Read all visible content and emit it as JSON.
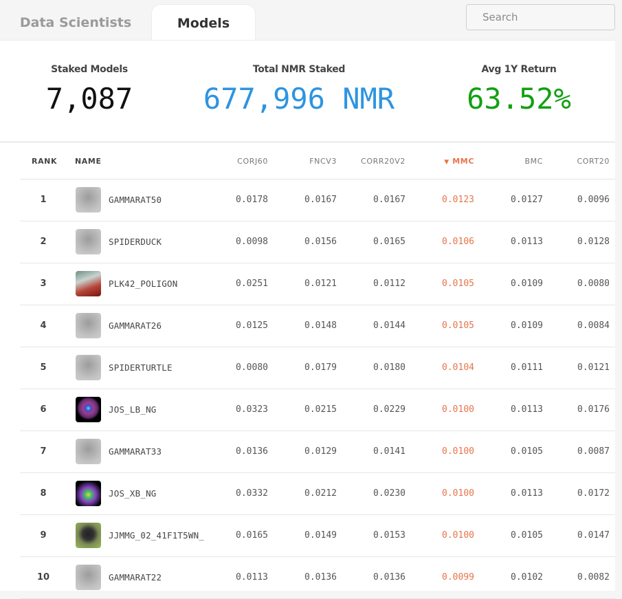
{
  "tabs": [
    {
      "label": "Data Scientists",
      "active": false
    },
    {
      "label": "Models",
      "active": true
    }
  ],
  "search": {
    "placeholder": "Search",
    "value": "",
    "icon": "search-icon"
  },
  "stats": [
    {
      "label": "Staked Models",
      "value": "7,087",
      "color": "#111111"
    },
    {
      "label": "Total NMR Staked",
      "value": "677,996 NMR",
      "color": "#2e94e0"
    },
    {
      "label": "Avg 1Y Return",
      "value": "63.52%",
      "color": "#12a012"
    }
  ],
  "table": {
    "columns": [
      "RANK",
      "NAME",
      "CORJ60",
      "FNCV3",
      "CORR20V2",
      "MMC",
      "BMC",
      "CORT20"
    ],
    "sort": {
      "column": "MMC",
      "direction": "desc",
      "indicator": "▼",
      "color": "#e8734a"
    },
    "rows": [
      {
        "rank": "1",
        "name": "GAMMARAT50",
        "avatar": "blur",
        "corj60": "0.0178",
        "fncv3": "0.0167",
        "corr20v2": "0.0167",
        "mmc": "0.0123",
        "bmc": "0.0127",
        "cort20": "0.0096"
      },
      {
        "rank": "2",
        "name": "SPIDERDUCK",
        "avatar": "blur",
        "corj60": "0.0098",
        "fncv3": "0.0156",
        "corr20v2": "0.0165",
        "mmc": "0.0106",
        "bmc": "0.0113",
        "cort20": "0.0128"
      },
      {
        "rank": "3",
        "name": "PLK42_POLIGON",
        "avatar": "art1",
        "corj60": "0.0251",
        "fncv3": "0.0121",
        "corr20v2": "0.0112",
        "mmc": "0.0105",
        "bmc": "0.0109",
        "cort20": "0.0080"
      },
      {
        "rank": "4",
        "name": "GAMMARAT26",
        "avatar": "blur",
        "corj60": "0.0125",
        "fncv3": "0.0148",
        "corr20v2": "0.0144",
        "mmc": "0.0105",
        "bmc": "0.0109",
        "cort20": "0.0084"
      },
      {
        "rank": "5",
        "name": "SPIDERTURTLE",
        "avatar": "blur",
        "corj60": "0.0080",
        "fncv3": "0.0179",
        "corr20v2": "0.0180",
        "mmc": "0.0104",
        "bmc": "0.0111",
        "cort20": "0.0121"
      },
      {
        "rank": "6",
        "name": "JOS_LB_NG",
        "avatar": "art2",
        "corj60": "0.0323",
        "fncv3": "0.0215",
        "corr20v2": "0.0229",
        "mmc": "0.0100",
        "bmc": "0.0113",
        "cort20": "0.0176"
      },
      {
        "rank": "7",
        "name": "GAMMARAT33",
        "avatar": "blur",
        "corj60": "0.0136",
        "fncv3": "0.0129",
        "corr20v2": "0.0141",
        "mmc": "0.0100",
        "bmc": "0.0105",
        "cort20": "0.0087"
      },
      {
        "rank": "8",
        "name": "JOS_XB_NG",
        "avatar": "art3",
        "corj60": "0.0332",
        "fncv3": "0.0212",
        "corr20v2": "0.0230",
        "mmc": "0.0100",
        "bmc": "0.0113",
        "cort20": "0.0172"
      },
      {
        "rank": "9",
        "name": "JJMMG_02_41F1T5WN_",
        "avatar": "art4",
        "corj60": "0.0165",
        "fncv3": "0.0149",
        "corr20v2": "0.0153",
        "mmc": "0.0100",
        "bmc": "0.0105",
        "cort20": "0.0147"
      },
      {
        "rank": "10",
        "name": "GAMMARAT22",
        "avatar": "blur",
        "corj60": "0.0113",
        "fncv3": "0.0136",
        "corr20v2": "0.0136",
        "mmc": "0.0099",
        "bmc": "0.0102",
        "cort20": "0.0082"
      }
    ]
  }
}
